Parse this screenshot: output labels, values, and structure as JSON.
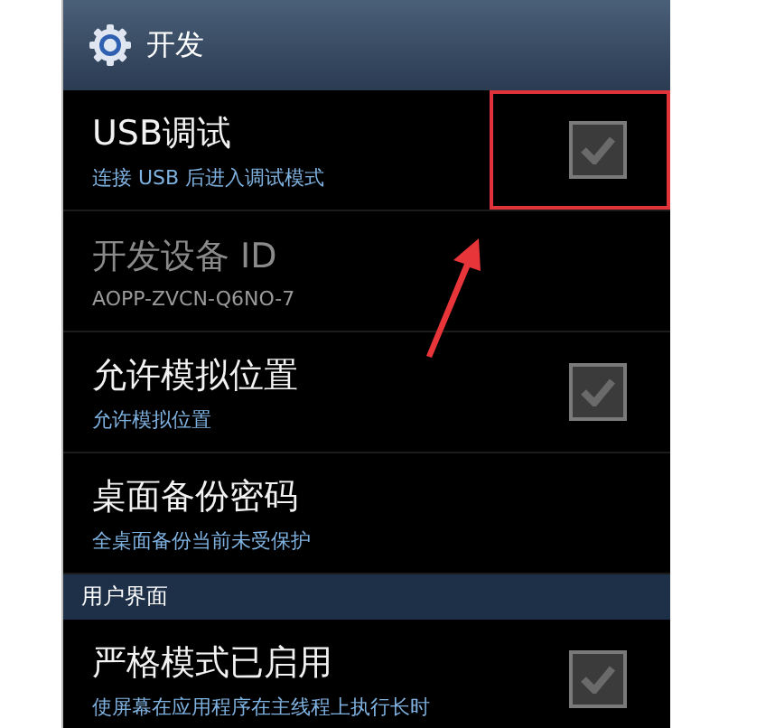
{
  "header": {
    "title": "开发"
  },
  "sections": [
    {
      "items": [
        {
          "kind": "checkbox",
          "title": "USB调试",
          "summary": "连接 USB 后进入调试模式",
          "disabled": false,
          "checked": true,
          "highlighted": true
        },
        {
          "kind": "info",
          "title": "开发设备 ID",
          "summary": "AOPP-ZVCN-Q6NO-7",
          "disabled": true
        },
        {
          "kind": "checkbox",
          "title": "允许模拟位置",
          "summary": "允许模拟位置",
          "disabled": false,
          "checked": true,
          "highlighted": false
        },
        {
          "kind": "info",
          "title": "桌面备份密码",
          "summary": "全桌面备份当前未受保护",
          "disabled": false
        }
      ]
    },
    {
      "heading": "用户界面",
      "items": [
        {
          "kind": "checkbox",
          "title": "严格模式已启用",
          "summary": "使屏幕在应用程序在主线程上执行长时",
          "disabled": false,
          "checked": true,
          "highlighted": false
        }
      ]
    }
  ]
}
